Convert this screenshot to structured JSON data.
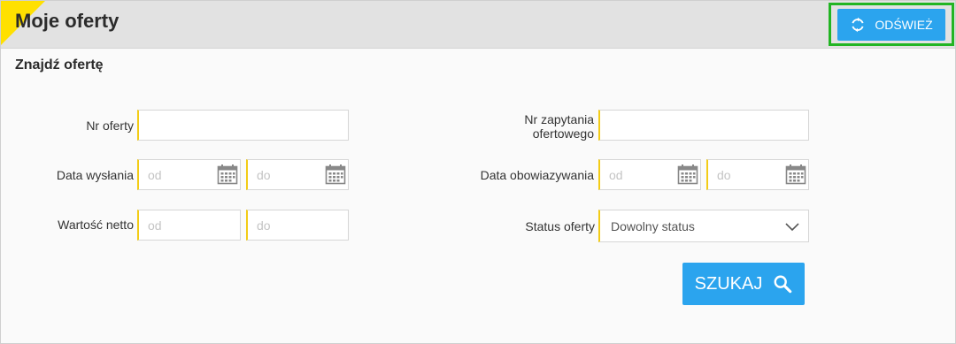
{
  "header": {
    "title": "Moje oferty",
    "refresh_label": "ODŚWIEŻ"
  },
  "search": {
    "title": "Znajdź ofertę",
    "offer_number": {
      "label": "Nr oferty",
      "value": "",
      "placeholder": ""
    },
    "sent_date": {
      "label": "Data wysłania",
      "from_placeholder": "od",
      "to_placeholder": "do"
    },
    "net_value": {
      "label": "Wartość netto",
      "from_placeholder": "od",
      "to_placeholder": "do"
    },
    "inquiry_number": {
      "label_line1": "Nr zapytania",
      "label_line2": "ofertowego",
      "value": ""
    },
    "validity_date": {
      "label": "Data obowiazywania",
      "from_placeholder": "od",
      "to_placeholder": "do"
    },
    "status": {
      "label": "Status oferty",
      "selected": "Dowolny status"
    },
    "search_label": "SZUKAJ"
  },
  "colors": {
    "accent_blue": "#2ba4ee",
    "accent_yellow": "#f3cc16",
    "highlight_green": "#22b523"
  },
  "icons": {
    "refresh": "refresh-icon",
    "calendar": "calendar-icon",
    "chevron": "chevron-down-icon",
    "search": "search-icon"
  }
}
